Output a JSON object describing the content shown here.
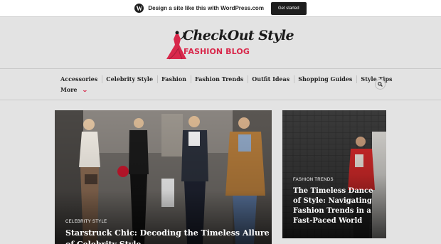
{
  "wp_bar": {
    "logo_glyph": "W",
    "message": "Design a site like this with WordPress.com",
    "cta_label": "Get started"
  },
  "site": {
    "logo_title": "CheckOut Style",
    "logo_subtitle": "FASHION BLOG",
    "accent_color": "#d8284b"
  },
  "nav": {
    "items": [
      {
        "label": "Accessories"
      },
      {
        "label": "Celebrity Style"
      },
      {
        "label": "Fashion"
      },
      {
        "label": "Fashion Trends"
      },
      {
        "label": "Outfit Ideas"
      },
      {
        "label": "Shopping Guides"
      },
      {
        "label": "Style Tips"
      }
    ],
    "more_label": "More",
    "more_icon": "chevron-down-icon",
    "search_icon": "search-icon"
  },
  "featured": {
    "main": {
      "category": "CELEBRITY STYLE",
      "title": "Starstruck Chic: Decoding the Timeless Allure of Celebrity Style"
    },
    "side": {
      "category": "FASHION TRENDS",
      "title": "The Timeless Dance of Style: Navigating Fashion Trends in a Fast-Paced World"
    }
  }
}
